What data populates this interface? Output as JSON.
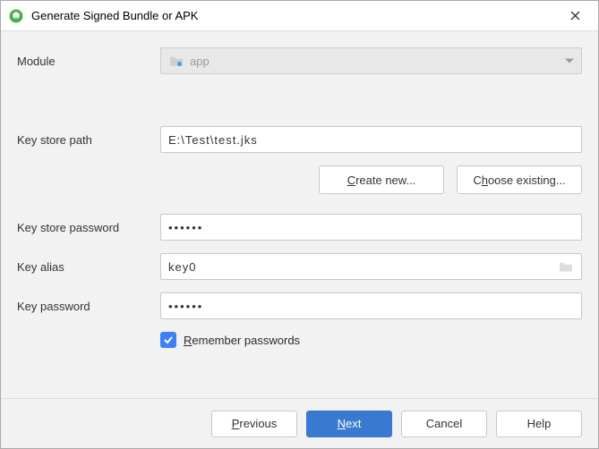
{
  "window": {
    "title": "Generate Signed Bundle or APK"
  },
  "form": {
    "module_label": "Module",
    "module_value": "app",
    "keystore_path_label": "Key store path",
    "keystore_path_value": "E:\\Test\\test.jks",
    "create_new_label": "Create new...",
    "create_new_mn": "C",
    "choose_existing_label": "Choose existing...",
    "choose_existing_mn": "h",
    "keystore_password_label": "Key store password",
    "keystore_password_value": "••••••",
    "key_alias_label": "Key alias",
    "key_alias_value": "key0",
    "key_password_label": "Key password",
    "key_password_value": "••••••",
    "remember_label": "Remember passwords",
    "remember_mn": "R",
    "remember_checked": true
  },
  "footer": {
    "previous": "Previous",
    "previous_mn": "P",
    "next": "Next",
    "next_mn": "N",
    "cancel": "Cancel",
    "help": "Help"
  }
}
